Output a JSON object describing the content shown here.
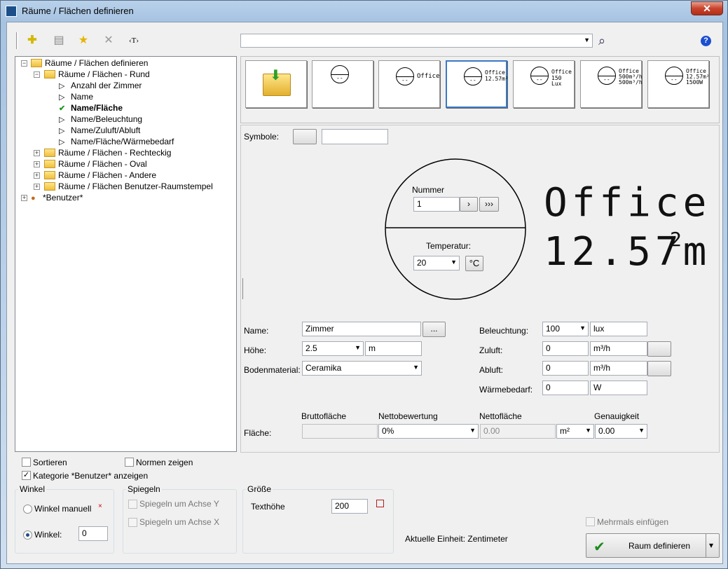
{
  "window": {
    "title": "Räume / Flächen definieren",
    "close": "✕"
  },
  "toolbar": {
    "add": "✚",
    "list": "▤",
    "star": "★",
    "delete": "✕",
    "text": "‹T›",
    "help": "?",
    "search_icon": "⌕"
  },
  "search": {
    "value": ""
  },
  "tree": {
    "root": "Räume / Flächen definieren",
    "rund": "Räume / Flächen - Rund",
    "items": [
      "Anzahl der Zimmer",
      "Name",
      "Name/Fläche",
      "Name/Beleuchtung",
      "Name/Zuluft/Abluft",
      "Name/Fläche/Wärmebedarf"
    ],
    "rechteckig": "Räume / Flächen - Rechteckig",
    "oval": "Räume / Flächen - Oval",
    "andere": "Räume / Flächen - Andere",
    "stempel": "Räume / Flächen Benutzer-Raumstempel",
    "benutzer": "*Benutzer*"
  },
  "thumbs": {
    "office": "Office",
    "t3a": "Office",
    "t3b": "12.57m²",
    "t4a": "Office",
    "t4b": "150 Lux",
    "t5a": "Office",
    "t5b": "500m³/h",
    "t5c": "500m³/h",
    "t6a": "Office",
    "t6b": "12.57m²",
    "t6c": "1500W",
    "dash": "--"
  },
  "form": {
    "symbole_label": "Symbole:",
    "nummer_label": "Nummer",
    "nummer_value": "1",
    "next": "›",
    "next_all": "›››",
    "temp_label": "Temperatur:",
    "temp_value": "20",
    "temp_unit": "°C",
    "preview_name": "Office",
    "preview_area": "12.57m",
    "preview_sup": "2",
    "name_label": "Name:",
    "name_value": "Zimmer",
    "ellipsis": "...",
    "hoehe_label": "Höhe:",
    "hoehe_value": "2.5",
    "hoehe_unit": "m",
    "boden_label": "Bodenmaterial:",
    "boden_value": "Ceramika",
    "bel_label": "Beleuchtung:",
    "bel_value": "100",
    "bel_unit": "lux",
    "zu_label": "Zuluft:",
    "zu_value": "0",
    "zu_unit": "m³/h",
    "ab_label": "Abluft:",
    "ab_value": "0",
    "ab_unit": "m³/h",
    "waerme_label": "Wärmebedarf:",
    "waerme_value": "0",
    "waerme_unit": "W",
    "flaeche_label": "Fläche:",
    "brutto_label": "Bruttofläche",
    "brutto_value": "",
    "nettob_label": "Nettobewertung",
    "nettob_value": "0%",
    "netto_label": "Nettofläche",
    "netto_value": "0.00",
    "netto_unit": "m²",
    "gen_label": "Genauigkeit",
    "gen_value": "0.00"
  },
  "bottom": {
    "sortieren": "Sortieren",
    "normen": "Normen zeigen",
    "kategorie": "Kategorie *Benutzer* anzeigen",
    "winkel_group": "Winkel",
    "winkel_manuell": "Winkel manuell",
    "winkel_label": "Winkel:",
    "winkel_value": "0",
    "spiegeln_group": "Spiegeln",
    "spiegeln_y": "Spiegeln um Achse Y",
    "spiegeln_x": "Spiegeln um Achse X",
    "groesse_group": "Größe",
    "texthoehe": "Texthöhe",
    "texthoehe_value": "200",
    "einheit": "Aktuelle Einheit: Zentimeter",
    "mehrmals": "Mehrmals einfügen",
    "raum_button": "Raum definieren",
    "check": "✔",
    "dropdown": "▾"
  }
}
